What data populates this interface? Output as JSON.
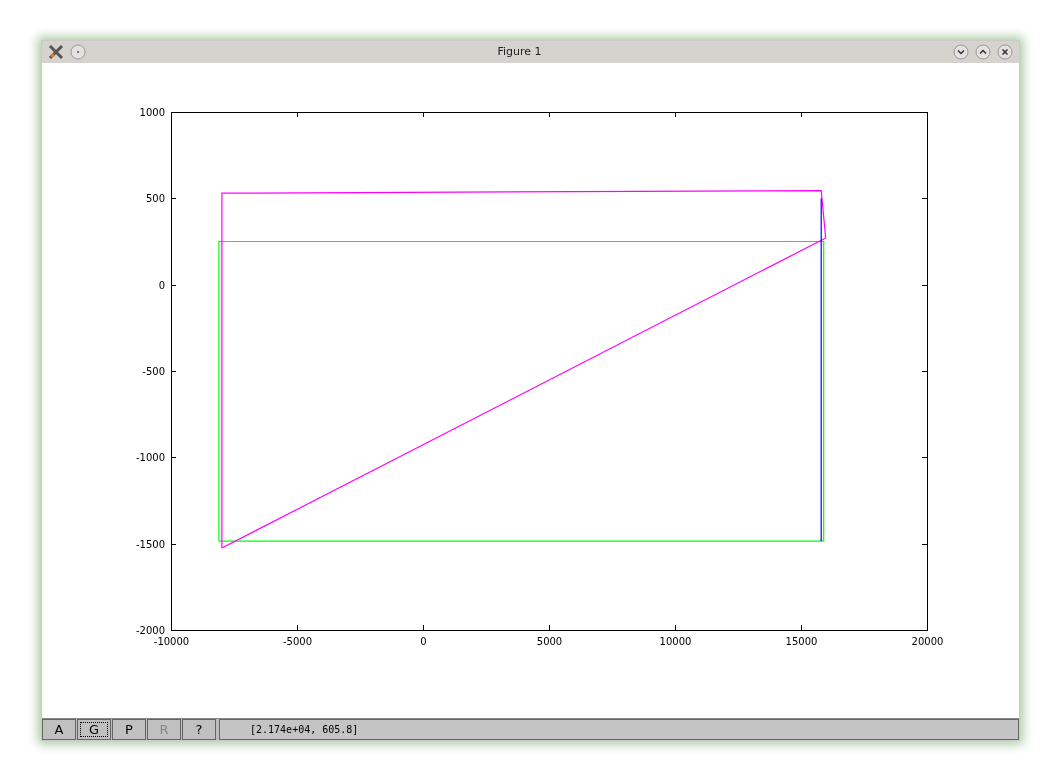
{
  "window": {
    "title": "Figure 1"
  },
  "figure": {
    "chart_data": {
      "type": "line",
      "xlim": [
        -10000,
        20000
      ],
      "ylim": [
        -2000,
        1000
      ],
      "xticks": [
        -10000,
        -5000,
        0,
        5000,
        10000,
        15000,
        20000
      ],
      "yticks": [
        -2000,
        -1500,
        -1000,
        -500,
        0,
        500,
        1000
      ],
      "series": [
        {
          "color": "#00ff00",
          "x": [
            -8100,
            -8100,
            15900,
            15900
          ],
          "values": [
            -1485,
            250,
            250,
            -1485
          ]
        },
        {
          "color": "#00ff00",
          "x": [
            -8100,
            15900
          ],
          "values": [
            -1485,
            -1485
          ]
        },
        {
          "color": "#ff00ff",
          "x": [
            -7980,
            -7980,
            15800,
            15980
          ],
          "values": [
            -1525,
            530,
            545,
            270
          ]
        },
        {
          "color": "#ff00ff",
          "x": [
            -7980,
            15980
          ],
          "values": [
            -1525,
            270
          ]
        },
        {
          "color": "#0000ff",
          "x": [
            15800,
            15800
          ],
          "values": [
            500,
            -1485
          ]
        }
      ]
    }
  },
  "toolbar": {
    "buttons": [
      {
        "label": "A",
        "disabled": false,
        "focused": false
      },
      {
        "label": "G",
        "disabled": false,
        "focused": true
      },
      {
        "label": "P",
        "disabled": false,
        "focused": false
      },
      {
        "label": "R",
        "disabled": true,
        "focused": false
      },
      {
        "label": "?",
        "disabled": false,
        "focused": false
      }
    ],
    "status": "[2.174e+04, 605.8]"
  }
}
